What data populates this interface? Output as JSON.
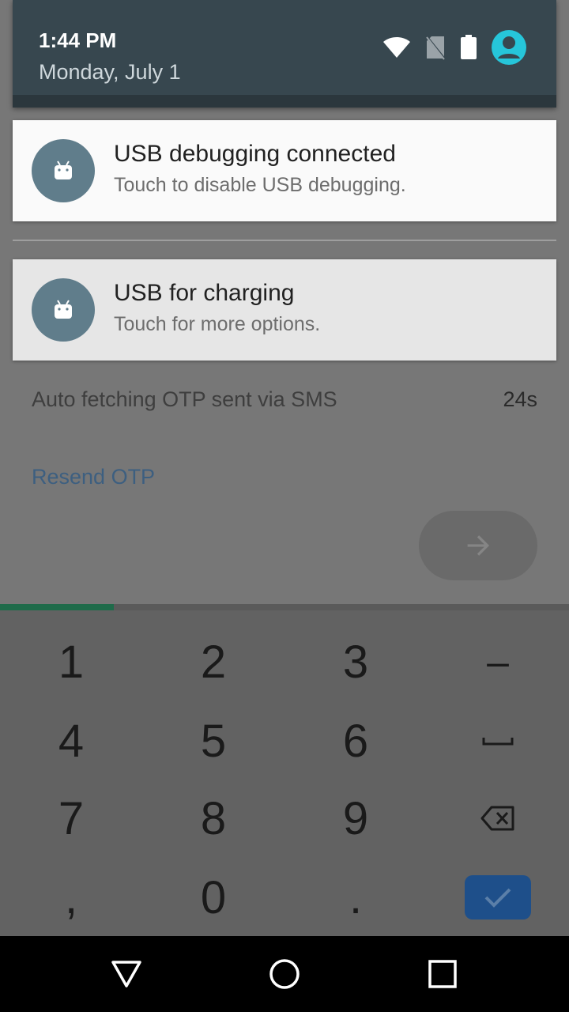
{
  "status": {
    "time": "1:44 PM",
    "date": "Monday, July 1",
    "icons": [
      "wifi-icon",
      "no-sim-icon",
      "battery-icon",
      "account-icon"
    ],
    "accent": "#26c6da"
  },
  "notifications": [
    {
      "title": "USB debugging connected",
      "subtitle": "Touch to disable USB debugging.",
      "icon": "android-debug-icon"
    },
    {
      "title": "USB for charging",
      "subtitle": "Touch for more options.",
      "icon": "android-usb-icon"
    }
  ],
  "app": {
    "otp_label": "Auto fetching OTP sent via SMS",
    "otp_timer": "24s",
    "resend_label": "Resend OTP",
    "next_icon": "arrow-right-icon",
    "progress_fraction": 0.2
  },
  "keypad": {
    "rows": [
      [
        "1",
        "2",
        "3",
        "–"
      ],
      [
        "4",
        "5",
        "6",
        "space"
      ],
      [
        "7",
        "8",
        "9",
        "backspace"
      ],
      [
        ",",
        "0",
        ".",
        "done"
      ]
    ],
    "done_color": "#1e4f8a"
  },
  "navbar": {
    "buttons": [
      "back-icon",
      "home-icon",
      "recents-icon"
    ]
  }
}
